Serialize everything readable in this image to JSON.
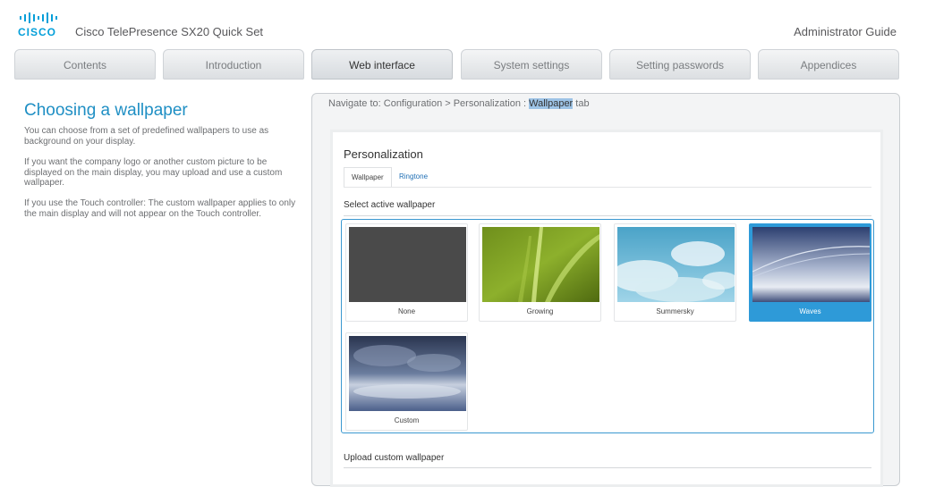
{
  "header": {
    "logo_text": "CISCO",
    "doc_title": "Cisco TelePresence SX20 Quick Set",
    "guide_title": "Administrator Guide"
  },
  "tabs": [
    {
      "label": "Contents",
      "active": false
    },
    {
      "label": "Introduction",
      "active": false
    },
    {
      "label": "Web interface",
      "active": true
    },
    {
      "label": "System settings",
      "active": false
    },
    {
      "label": "Setting passwords",
      "active": false
    },
    {
      "label": "Appendices",
      "active": false
    }
  ],
  "left": {
    "heading": "Choosing a wallpaper",
    "paragraphs": [
      "You can choose from a set of predefined wallpapers to use as background on your display.",
      "If you want the company logo or another custom picture to be displayed on the main display, you may upload and use a custom wallpaper.",
      "If you use the Touch controller: The custom wallpaper applies to only the main display and will not appear on the Touch controller."
    ]
  },
  "panel": {
    "nav_prefix": "Navigate to: Configuration > Personalization : ",
    "nav_highlight": "Wallpaper",
    "nav_suffix": " tab",
    "title": "Personalization",
    "subtabs": [
      "Wallpaper",
      "Ringtone"
    ],
    "select_label": "Select active wallpaper",
    "wallpapers": [
      {
        "name": "None",
        "selected": false
      },
      {
        "name": "Growing",
        "selected": false
      },
      {
        "name": "Summersky",
        "selected": false
      },
      {
        "name": "Waves",
        "selected": true
      },
      {
        "name": "Custom",
        "selected": false
      }
    ],
    "upload_label": "Upload custom wallpaper"
  },
  "colors": {
    "accent": "#1f8fc4",
    "selection": "#2e9ad8",
    "cisco_blue": "#049fd9"
  }
}
